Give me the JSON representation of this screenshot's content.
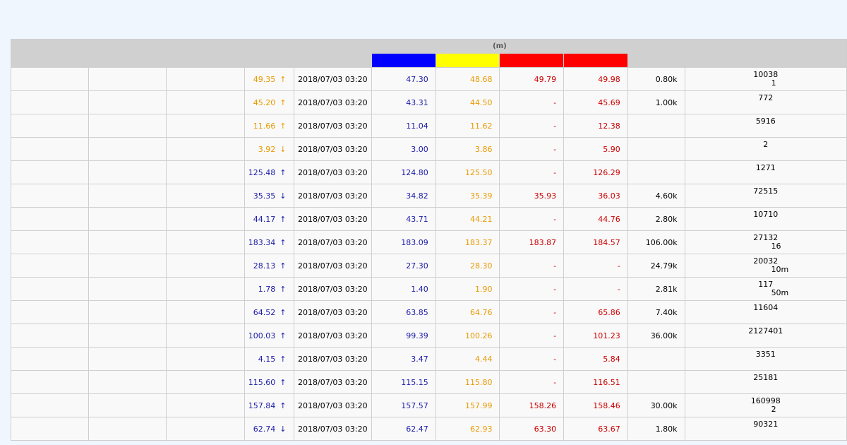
{
  "header": {
    "group_label": "(m)",
    "swatch_colors": [
      "#0000ff",
      "#ffff00",
      "#ff0000",
      "#ff0000"
    ]
  },
  "colors": {
    "blue": "#1c1ca8",
    "orange": "#e89a00",
    "red": "#cc0000"
  },
  "rows": [
    {
      "price": "49.35",
      "arrow": "↑",
      "price_color": "orange",
      "time": "2018/07/03 03:20",
      "c1": "47.30",
      "c2": "48.68",
      "c3": "49.79",
      "c4": "49.98",
      "vol": "0.80k",
      "cnt": "10038",
      "cnt2": "1"
    },
    {
      "price": "45.20",
      "arrow": "↑",
      "price_color": "orange",
      "time": "2018/07/03 03:20",
      "c1": "43.31",
      "c2": "44.50",
      "c3": "-",
      "c4": "45.69",
      "vol": "1.00k",
      "cnt": "772",
      "cnt2": ""
    },
    {
      "price": "11.66",
      "arrow": "↑",
      "price_color": "orange",
      "time": "2018/07/03 03:20",
      "c1": "11.04",
      "c2": "11.62",
      "c3": "-",
      "c4": "12.38",
      "vol": "",
      "cnt": "5916",
      "cnt2": ""
    },
    {
      "price": "3.92",
      "arrow": "↓",
      "price_color": "orange",
      "time": "2018/07/03 03:20",
      "c1": "3.00",
      "c2": "3.86",
      "c3": "-",
      "c4": "5.90",
      "vol": "",
      "cnt": "2",
      "cnt2": ""
    },
    {
      "price": "125.48",
      "arrow": "↑",
      "price_color": "blue",
      "time": "2018/07/03 03:20",
      "c1": "124.80",
      "c2": "125.50",
      "c3": "-",
      "c4": "126.29",
      "vol": "",
      "cnt": "1271",
      "cnt2": ""
    },
    {
      "price": "35.35",
      "arrow": "↓",
      "price_color": "blue",
      "time": "2018/07/03 03:20",
      "c1": "34.82",
      "c2": "35.39",
      "c3": "35.93",
      "c4": "36.03",
      "vol": "4.60k",
      "cnt": "72515",
      "cnt2": ""
    },
    {
      "price": "44.17",
      "arrow": "↑",
      "price_color": "blue",
      "time": "2018/07/03 03:20",
      "c1": "43.71",
      "c2": "44.21",
      "c3": "-",
      "c4": "44.76",
      "vol": "2.80k",
      "cnt": "10710",
      "cnt2": ""
    },
    {
      "price": "183.34",
      "arrow": "↑",
      "price_color": "blue",
      "time": "2018/07/03 03:20",
      "c1": "183.09",
      "c2": "183.37",
      "c3": "183.87",
      "c4": "184.57",
      "vol": "106.00k",
      "cnt": "27132",
      "cnt2": "16"
    },
    {
      "price": "28.13",
      "arrow": "↑",
      "price_color": "blue",
      "time": "2018/07/03 03:20",
      "c1": "27.30",
      "c2": "28.30",
      "c3": "-",
      "c4": "-",
      "vol": "24.79k",
      "cnt": "20032",
      "cnt2": "10m"
    },
    {
      "price": "1.78",
      "arrow": "↑",
      "price_color": "blue",
      "time": "2018/07/03 03:20",
      "c1": "1.40",
      "c2": "1.90",
      "c3": "-",
      "c4": "-",
      "vol": "2.81k",
      "cnt": "117",
      "cnt2": "50m"
    },
    {
      "price": "64.52",
      "arrow": "↑",
      "price_color": "blue",
      "time": "2018/07/03 03:20",
      "c1": "63.85",
      "c2": "64.76",
      "c3": "-",
      "c4": "65.86",
      "vol": "7.40k",
      "cnt": "11604",
      "cnt2": ""
    },
    {
      "price": "100.03",
      "arrow": "↑",
      "price_color": "blue",
      "time": "2018/07/03 03:20",
      "c1": "99.39",
      "c2": "100.26",
      "c3": "-",
      "c4": "101.23",
      "vol": "36.00k",
      "cnt": "2127401",
      "cnt2": ""
    },
    {
      "price": "4.15",
      "arrow": "↑",
      "price_color": "blue",
      "time": "2018/07/03 03:20",
      "c1": "3.47",
      "c2": "4.44",
      "c3": "-",
      "c4": "5.84",
      "vol": "",
      "cnt": "3351",
      "cnt2": ""
    },
    {
      "price": "115.60",
      "arrow": "↑",
      "price_color": "blue",
      "time": "2018/07/03 03:20",
      "c1": "115.15",
      "c2": "115.80",
      "c3": "-",
      "c4": "116.51",
      "vol": "",
      "cnt": "25181",
      "cnt2": ""
    },
    {
      "price": "157.84",
      "arrow": "↑",
      "price_color": "blue",
      "time": "2018/07/03 03:20",
      "c1": "157.57",
      "c2": "157.99",
      "c3": "158.26",
      "c4": "158.46",
      "vol": "30.00k",
      "cnt": "160998",
      "cnt2": "2"
    },
    {
      "price": "62.74",
      "arrow": "↓",
      "price_color": "blue",
      "time": "2018/07/03 03:20",
      "c1": "62.47",
      "c2": "62.93",
      "c3": "63.30",
      "c4": "63.67",
      "vol": "1.80k",
      "cnt": "90321",
      "cnt2": ""
    }
  ]
}
